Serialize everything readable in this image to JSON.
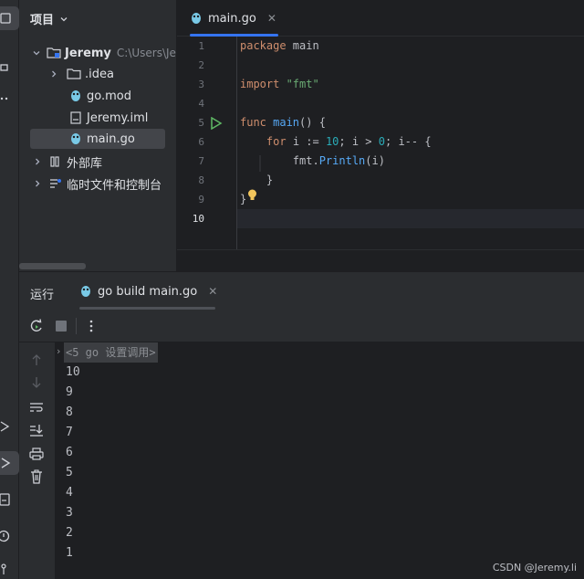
{
  "project": {
    "title": "项目",
    "tree": [
      {
        "label": "Jeremy",
        "hint": "C:\\Users\\Jer"
      },
      {
        "label": ".idea"
      },
      {
        "label": "go.mod"
      },
      {
        "label": "Jeremy.iml"
      },
      {
        "label": "main.go"
      },
      {
        "label": "外部库"
      },
      {
        "label": "临时文件和控制台"
      }
    ]
  },
  "editor": {
    "tab_label": "main.go",
    "line_numbers": [
      "1",
      "2",
      "3",
      "4",
      "5",
      "6",
      "7",
      "8",
      "9",
      "10"
    ],
    "code": {
      "l1_kw": "package",
      "l1_name": " main",
      "l3_kw": "import",
      "l3_str": " \"fmt\"",
      "l5_kw": "func",
      "l5_fn": " main",
      "l5_rest": "() {",
      "l6_indent": "    ",
      "l6_kw": "for",
      "l6_a": " i := ",
      "l6_n1": "10",
      "l6_b": "; i > ",
      "l6_n2": "0",
      "l6_c": "; i-- {",
      "l7_indent": "        ",
      "l7_pkg": "fmt.",
      "l7_fn": "Println",
      "l7_rest": "(i)",
      "l8": "    }",
      "l9": "}"
    }
  },
  "run": {
    "label": "运行",
    "tab_label": "go build main.go",
    "console_header": "<5 go 设置调用>",
    "output": [
      "10",
      "9",
      "8",
      "7",
      "6",
      "5",
      "4",
      "3",
      "2",
      "1"
    ]
  },
  "watermark": "CSDN @Jeremy.li",
  "colors": {
    "accent": "#3574f0",
    "keyword": "#cf8e6d",
    "function": "#56a8f5",
    "string": "#6aab73",
    "number": "#2aacb8",
    "run_green": "#5fb865",
    "bulb": "#f2c55c"
  }
}
